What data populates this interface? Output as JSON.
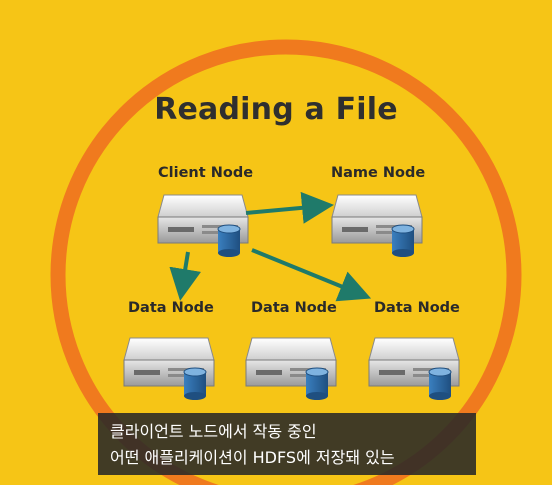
{
  "title": "Reading a File",
  "nodes": {
    "client": "Client Node",
    "name": "Name Node",
    "data1": "Data Node",
    "data2": "Data Node",
    "data3": "Data Node"
  },
  "subtitle": {
    "line1": "클라이언트 노드에서 작동 중인",
    "line2": "어떤 애플리케이션이 HDFS에 저장돼 있는"
  },
  "colors": {
    "background": "#f6c516",
    "ring": "#f07a1e",
    "arrow": "#1f7a6a",
    "server_body": "#d9d9d9",
    "database": "#2f6fa8"
  }
}
